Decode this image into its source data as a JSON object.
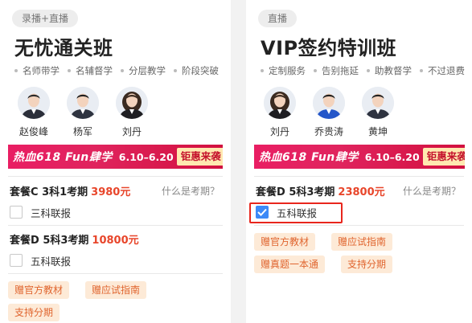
{
  "left": {
    "type": "录播+直播",
    "title": "无忧通关班",
    "features": [
      "名师带学",
      "名辅督学",
      "分层教学",
      "阶段突破"
    ],
    "teachers": [
      {
        "name": "赵俊峰",
        "gender": "male",
        "suit": "#2b2f3a",
        "hair": "#2a2a2a"
      },
      {
        "name": "杨军",
        "gender": "male",
        "suit": "#2e3340",
        "hair": "#1f1f1f"
      },
      {
        "name": "刘丹",
        "gender": "female",
        "suit": "#1e1e22",
        "hair": "#3a2a20"
      }
    ],
    "banner": {
      "main": "热血618 Fun肆学",
      "date": "6.10–6.20",
      "sale": "钜惠来袭"
    },
    "packages": [
      {
        "name": "套餐C 3科1考期",
        "price": "3980元",
        "help": "什么是考期？",
        "option": "三科联报",
        "checked": false
      },
      {
        "name": "套餐D 5科3考期",
        "price": "10800元",
        "option": "五科联报",
        "checked": false
      }
    ],
    "gifts": [
      "赠官方教材",
      "赠应试指南",
      "支持分期"
    ]
  },
  "right": {
    "type": "直播",
    "title": "VIP签约特训班",
    "features": [
      "定制服务",
      "告别拖延",
      "助教督学",
      "不过退费"
    ],
    "teachers": [
      {
        "name": "刘丹",
        "gender": "female",
        "suit": "#1e1e22",
        "hair": "#3a2a20"
      },
      {
        "name": "乔贵涛",
        "gender": "male",
        "suit": "#2456c9",
        "hair": "#1f1f1f"
      },
      {
        "name": "黄坤",
        "gender": "male",
        "suit": "#2e3340",
        "hair": "#222"
      }
    ],
    "banner": {
      "main": "热血618 Fun肆学",
      "date": "6.10–6.20",
      "sale": "钜惠来袭"
    },
    "packages": [
      {
        "name": "套餐D 5科3考期",
        "price": "23800元",
        "help": "什么是考期？",
        "option": "五科联报",
        "checked": true
      }
    ],
    "gifts": [
      "赠官方教材",
      "赠应试指南",
      "赠真题一本通",
      "支持分期"
    ]
  },
  "colors": {
    "price": "#e8462b",
    "banner": "#e0245e",
    "gift_bg": "#fdead7",
    "gift_text": "#e0652f",
    "checkbox": "#3d8af7",
    "highlight": "#e8261d"
  }
}
